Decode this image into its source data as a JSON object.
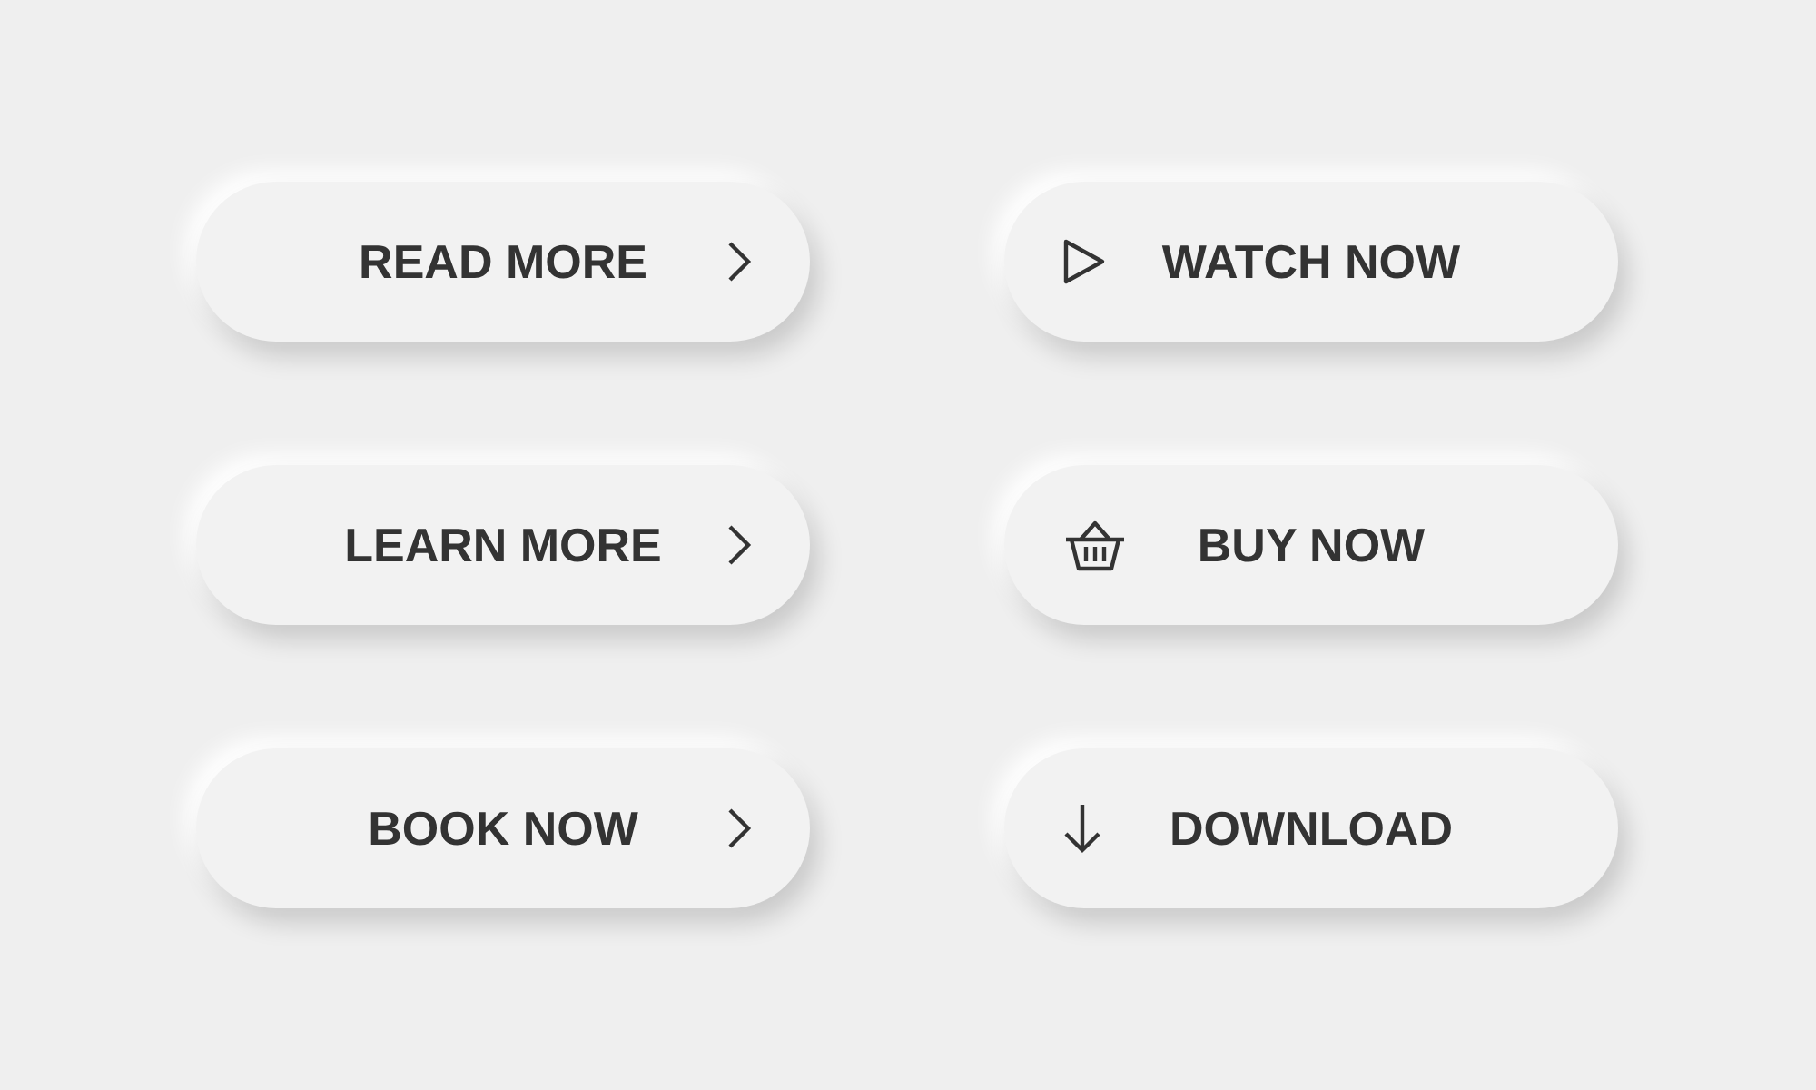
{
  "buttons": [
    {
      "label": "READ MORE",
      "kind": "chevron"
    },
    {
      "label": "WATCH NOW",
      "kind": "play"
    },
    {
      "label": "LEARN MORE",
      "kind": "chevron"
    },
    {
      "label": "BUY NOW",
      "kind": "basket"
    },
    {
      "label": "BOOK NOW",
      "kind": "chevron"
    },
    {
      "label": "DOWNLOAD",
      "kind": "download"
    }
  ]
}
